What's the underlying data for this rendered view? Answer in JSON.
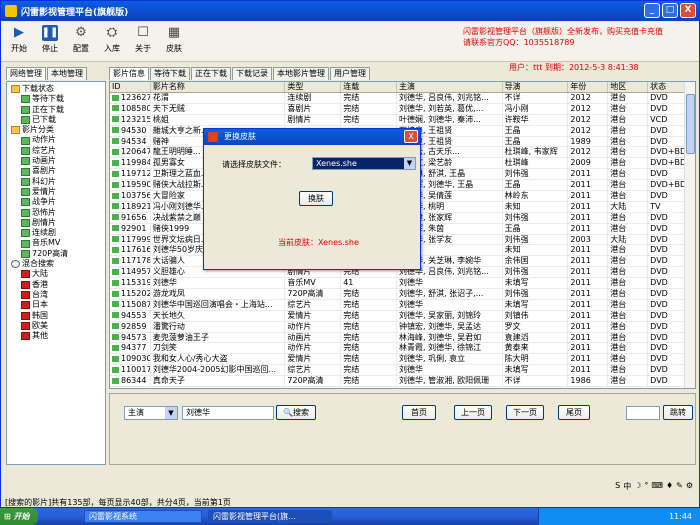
{
  "window": {
    "title": "闪雷影视管理平台(旗舰版)",
    "controls": [
      "_",
      "□",
      "X"
    ]
  },
  "toolbar": {
    "buttons": [
      {
        "label": "开始",
        "icon": "play-icon"
      },
      {
        "label": "停止",
        "icon": "pause-icon"
      },
      {
        "label": "配置",
        "icon": "settings-icon"
      },
      {
        "label": "入库",
        "icon": "import-icon"
      },
      {
        "label": "关于",
        "icon": "about-icon"
      },
      {
        "label": "皮肤",
        "icon": "skin-icon"
      }
    ],
    "banner_line1": "闪雷影视管理平台（旗舰版）全新发布，购买充值卡充值",
    "banner_line2": "请联系官方QQ：1035518789",
    "user_info": "用户：ttt  到期：2012-5-3  8:41:38"
  },
  "left_tabs": [
    "网络管理",
    "本地管理"
  ],
  "tree": [
    {
      "label": "下载状态",
      "icon": "folder",
      "indent": 0
    },
    {
      "label": "等待下载",
      "icon": "green",
      "indent": 1
    },
    {
      "label": "正在下载",
      "icon": "green",
      "indent": 1
    },
    {
      "label": "已下载",
      "icon": "green",
      "indent": 1
    },
    {
      "label": "影片分类",
      "icon": "folder",
      "indent": 0
    },
    {
      "label": "动作片",
      "icon": "green",
      "indent": 1
    },
    {
      "label": "综艺片",
      "icon": "green",
      "indent": 1
    },
    {
      "label": "动画片",
      "icon": "green",
      "indent": 1
    },
    {
      "label": "喜剧片",
      "icon": "green",
      "indent": 1
    },
    {
      "label": "科幻片",
      "icon": "green",
      "indent": 1
    },
    {
      "label": "爱情片",
      "icon": "green",
      "indent": 1
    },
    {
      "label": "战争片",
      "icon": "green",
      "indent": 1
    },
    {
      "label": "恐怖片",
      "icon": "green",
      "indent": 1
    },
    {
      "label": "剧情片",
      "icon": "green",
      "indent": 1
    },
    {
      "label": "连续剧",
      "icon": "green",
      "indent": 1
    },
    {
      "label": "音乐MV",
      "icon": "green",
      "indent": 1
    },
    {
      "label": "720P高清",
      "icon": "green",
      "indent": 1
    },
    {
      "label": "混合搜索",
      "icon": "search",
      "indent": 0
    },
    {
      "label": "大陆",
      "icon": "red",
      "indent": 1
    },
    {
      "label": "香港",
      "icon": "red",
      "indent": 1
    },
    {
      "label": "台湾",
      "icon": "red",
      "indent": 1
    },
    {
      "label": "日本",
      "icon": "red",
      "indent": 1
    },
    {
      "label": "韩国",
      "icon": "red",
      "indent": 1
    },
    {
      "label": "欧美",
      "icon": "red",
      "indent": 1
    },
    {
      "label": "其他",
      "icon": "red",
      "indent": 1
    }
  ],
  "right_tabs": [
    "影片信息",
    "等待下载",
    "正在下载",
    "下载记录",
    "本地影片管理",
    "用户管理"
  ],
  "columns": [
    "ID",
    "影片名称",
    "类型",
    "连载",
    "主演",
    "导演",
    "年份",
    "地区",
    "状态"
  ],
  "rows": [
    [
      "123627",
      "花渭",
      "连续剧",
      "完结",
      "刘德华, 吕良伟, 刘兆铭...",
      "不详",
      "2012",
      "港台",
      "DVD"
    ],
    [
      "108580",
      "天下无贼",
      "喜剧片",
      "完结",
      "刘德华, 刘若英, 葛优,...",
      "冯小刚",
      "2012",
      "港台",
      "DVD"
    ],
    [
      "123215",
      "桃姐",
      "剧情片",
      "完结",
      "叶德娴, 刘德华, 秦沛...",
      "许鞍华",
      "2012",
      "港台",
      "VCD"
    ],
    [
      "94530",
      "雜城大亨之新...",
      "",
      "",
      "万梓良, 王祖贤",
      "王晶",
      "2012",
      "港台",
      "DVD"
    ],
    [
      "94534",
      "赌神",
      "",
      "",
      "万梓良, 王祖贤",
      "王晶",
      "1989",
      "港台",
      "DVD"
    ],
    [
      "120647",
      "龍王明明睡...",
      "",
      "",
      "刘青云, 古天乐...",
      "杜琪峰, 韦家辉",
      "2012",
      "港台",
      "DVD+BD"
    ],
    [
      "119984",
      "孤男寡女",
      "",
      "",
      "郑秀文, 梁艺龄",
      "杜琪峰",
      "2009",
      "港台",
      "DVD+BD"
    ],
    [
      "119712",
      "卫斯理之蓝血...",
      "",
      "",
      "关之琳, 舒淇, 王晶",
      "刘伟强",
      "2011",
      "港台",
      "DVD"
    ],
    [
      "119590",
      "赌侠大战拉斯...",
      "",
      "",
      "张家辉, 刘德华, 王晶",
      "王晶",
      "2011",
      "港台",
      "DVD+BD"
    ],
    [
      "103756",
      "大冒险家",
      "",
      "",
      "刘德华, 吴倩莲",
      "林岭东",
      "2011",
      "港台",
      "DVD"
    ],
    [
      "118921",
      "冯小刚刘德华...",
      "",
      "",
      "刘德华, 桃明",
      "未知",
      "2011",
      "大陆",
      "TV"
    ],
    [
      "91656",
      "决战紫禁之巅",
      "",
      "",
      "郑伊健, 张家辉",
      "刘伟强",
      "2011",
      "港台",
      "DVD"
    ],
    [
      "92901",
      "赌侠1999",
      "",
      "",
      "张家辉, 朱茵",
      "王晶",
      "2011",
      "港台",
      "DVD"
    ],
    [
      "117999",
      "世界文坛病日...",
      "",
      "",
      "刘德华, 张学友",
      "刘伟强",
      "2003",
      "大陆",
      "DVD"
    ],
    [
      "117616",
      "刘德华50岁庆...",
      "",
      "",
      "",
      "未知",
      "2011",
      "港台",
      "DVD"
    ],
    [
      "117178",
      "大话骗人",
      "爱情片",
      "完结",
      "刘德华, 关芝琳, 李婉华",
      "余伟国",
      "2011",
      "港台",
      "DVD"
    ],
    [
      "114957",
      "义胆雄心",
      "剧情片",
      "完结",
      "刘德华, 吕良伟, 刘兆铭...",
      "刘伟强",
      "2011",
      "港台",
      "DVD"
    ],
    [
      "115319",
      "刘德华",
      "音乐MV",
      "41",
      "刘德华",
      "未填写",
      "2011",
      "港台",
      "DVD"
    ],
    [
      "115202",
      "游龙戏凤",
      "720P高清",
      "完结",
      "刘德华, 舒淇, 张诏子,...",
      "刘伟强",
      "2011",
      "港台",
      "DVD"
    ],
    [
      "115087",
      "刘德华中国巡回演唱会・上海站...",
      "综艺片",
      "完结",
      "刘德华",
      "未填写",
      "2011",
      "港台",
      "DVD"
    ],
    [
      "94553",
      "天长地久",
      "爱情片",
      "完结",
      "刘德华, 吴家丽, 刘锦玲",
      "刘镇伟",
      "2011",
      "港台",
      "DVD"
    ],
    [
      "92859",
      "潘驚行动",
      "动作片",
      "完结",
      "钟镇宏, 刘德华, 吴孟达",
      "罗文",
      "2011",
      "港台",
      "DVD"
    ],
    [
      "94573",
      "麦兜菠萝油王子",
      "动画片",
      "完结",
      "林海峰, 刘德华, 吴君如",
      "袁建滔",
      "2011",
      "港台",
      "DVD"
    ],
    [
      "94377",
      "刀剑笑",
      "动作片",
      "完结",
      "林青霞, 刘德华, 徐锦江",
      "黄泰来",
      "2011",
      "港台",
      "DVD"
    ],
    [
      "109030",
      "我和女人心/秀心大盗",
      "爱情片",
      "完结",
      "刘德华, 巩俐, 袁立",
      "陈大明",
      "2011",
      "港台",
      "DVD"
    ],
    [
      "110017",
      "刘德华2004-2005幻影中国巡回...",
      "综艺片",
      "完结",
      "刘德华",
      "未填写",
      "2011",
      "港台",
      "DVD"
    ],
    [
      "86344",
      "真命天子",
      "720P高清",
      "完结",
      "刘德华, 管淑湘, 欧阳佩珊",
      "不详",
      "1986",
      "港台",
      "DVD"
    ]
  ],
  "search": {
    "field": "主演",
    "keyword": "刘德华",
    "search_label": "搜索",
    "first_label": "首页",
    "prev_label": "上一页",
    "next_label": "下一页",
    "last_label": "尾页",
    "jump_label": "跳转"
  },
  "status_text": "[搜索的影片]共有135部，每页显示40部，共分4页，当前第1页",
  "tray_icons": [
    "S",
    "中",
    "☽",
    "°",
    "⌨",
    "♦",
    "✎",
    "⚙"
  ],
  "dialog": {
    "title": "更换皮肤",
    "label": "请选择皮肤文件：",
    "selected": "Xenes.she",
    "button": "换肤",
    "current": "当前皮肤：Xenes.she",
    "close": "X"
  },
  "taskbar": {
    "start_label": "开始",
    "tasks": [
      "闪雷影视系统",
      "闪雷影视管理平台(旗..."
    ],
    "clock": "11:44"
  }
}
